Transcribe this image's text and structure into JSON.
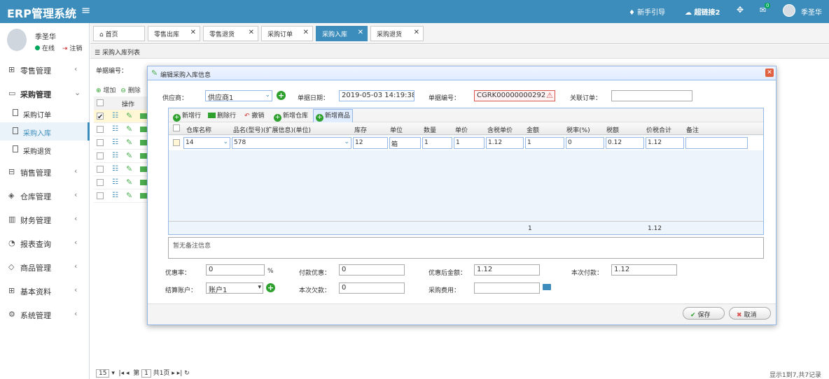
{
  "app": {
    "title": "ERP管理系统",
    "menu_icon": "hamburger-icon"
  },
  "topnav": {
    "guide": "新手引导",
    "link": "超链接2",
    "badge": "0",
    "user": "季圣华"
  },
  "sidebar": {
    "user_name": "季圣华",
    "status": "在线",
    "logout": "注销",
    "items": [
      {
        "label": "零售管理",
        "icon": "gift-icon"
      },
      {
        "label": "采购管理",
        "icon": "monitor-icon"
      },
      {
        "label": "销售管理",
        "icon": "briefcase-icon"
      },
      {
        "label": "仓库管理",
        "icon": "layers-icon"
      },
      {
        "label": "财务管理",
        "icon": "book-icon"
      },
      {
        "label": "报表查询",
        "icon": "clock-icon"
      },
      {
        "label": "商品管理",
        "icon": "cube-icon"
      },
      {
        "label": "基本资料",
        "icon": "grid-icon"
      },
      {
        "label": "系统管理",
        "icon": "gear-icon"
      }
    ],
    "sub_items": [
      "采购订单",
      "采购入库",
      "采购退货"
    ]
  },
  "tabs": [
    {
      "label": "首页"
    },
    {
      "label": "零售出库"
    },
    {
      "label": "零售退货"
    },
    {
      "label": "采购订单"
    },
    {
      "label": "采购入库"
    },
    {
      "label": "采购退货"
    }
  ],
  "background": {
    "panel_title": "采购入库列表",
    "search_label": "单据编号：",
    "add_label": "增加",
    "delete_label": "删除",
    "ops_header": "操作",
    "pager_size": "15",
    "pager_text": "第",
    "pager_page": "1",
    "pager_total": "共1页",
    "footer": "显示1到7,共7记录"
  },
  "dialog": {
    "title": "编辑采购入库信息",
    "supplier_label": "供应商：",
    "supplier_value": "供应商1",
    "date_label": "单据日期：",
    "date_value": "2019-05-03 14:19:38",
    "number_label": "单据编号：",
    "number_value": "CGRK00000000292",
    "linked_label": "关联订单：",
    "linked_value": "",
    "grid": {
      "toolbar": [
        "新增行",
        "删除行",
        "撤销",
        "新增仓库",
        "新增商品"
      ],
      "headers": [
        "仓库名称",
        "品名(型号)(扩展信息)(单位)",
        "库存",
        "单位",
        "数量",
        "单价",
        "含税单价",
        "金额",
        "税率(%)",
        "税额",
        "价税合计",
        "备注"
      ],
      "row": [
        "14",
        "578",
        "12",
        "箱",
        "1",
        "1",
        "1.12",
        "1",
        "0",
        "0.12",
        "1.12",
        ""
      ],
      "footer_amount": "1",
      "footer_total": "1.12"
    },
    "remark_placeholder": "暂无备注信息",
    "discount_rate_label": "优惠率：",
    "discount_rate_value": "0",
    "discount_rate_unit": "%",
    "pay_discount_label": "付款优惠：",
    "pay_discount_value": "0",
    "after_discount_label": "优惠后金额：",
    "after_discount_value": "1.12",
    "this_pay_label": "本次付款：",
    "this_pay_value": "1.12",
    "account_label": "结算账户：",
    "account_value": "账户1",
    "debt_label": "本次欠款：",
    "debt_value": "0",
    "purchase_fee_label": "采购费用：",
    "purchase_fee_value": "",
    "save_label": "保存",
    "cancel_label": "取消"
  }
}
